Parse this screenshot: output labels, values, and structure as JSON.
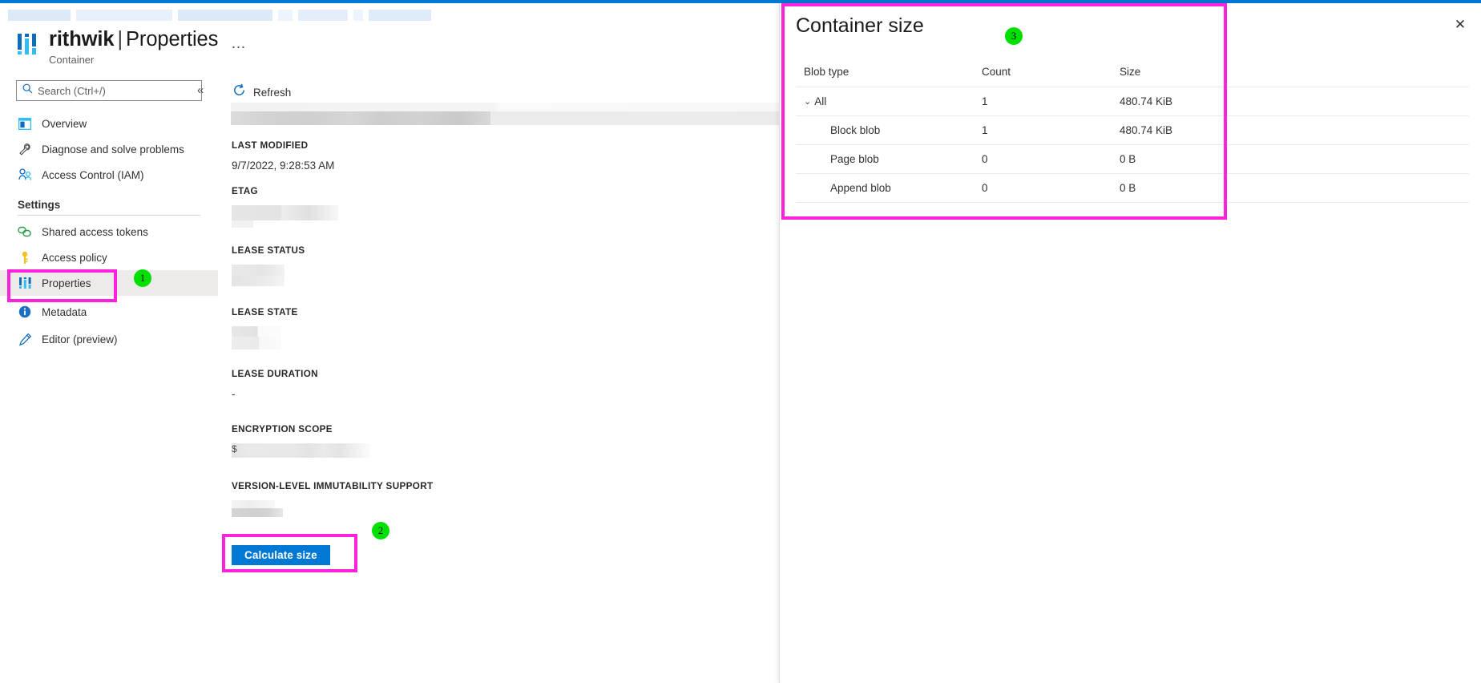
{
  "theme": {
    "azure_blue": "#0078d4",
    "highlight_pink": "#ff22dd",
    "badge_green": "#00e000"
  },
  "header": {
    "title_main": "rithwik",
    "title_separator": "|",
    "title_page": "Properties",
    "subtitle": "Container",
    "more_menu": "…",
    "resource_icon": "container-properties-icon"
  },
  "sidebar": {
    "search": {
      "placeholder": "Search (Ctrl+/)",
      "value": "",
      "icon": "search-icon"
    },
    "collapse": {
      "glyph": "«"
    },
    "items": [
      {
        "label": "Overview",
        "icon": "overview-icon",
        "selected": false
      },
      {
        "label": "Diagnose and solve problems",
        "icon": "wrench-icon",
        "selected": false
      },
      {
        "label": "Access Control (IAM)",
        "icon": "people-icon",
        "selected": false
      }
    ],
    "group_title": "Settings",
    "settings_items": [
      {
        "label": "Shared access tokens",
        "icon": "link-tokens-icon",
        "selected": false
      },
      {
        "label": "Access policy",
        "icon": "key-icon",
        "selected": false
      },
      {
        "label": "Properties",
        "icon": "properties-bars-icon",
        "selected": true
      },
      {
        "label": "Metadata",
        "icon": "info-icon",
        "selected": false
      },
      {
        "label": "Editor (preview)",
        "icon": "pencil-icon",
        "selected": false
      }
    ]
  },
  "toolbar": {
    "refresh_label": "Refresh",
    "refresh_icon": "refresh-icon"
  },
  "properties": [
    {
      "label": "LAST MODIFIED",
      "value": "9/7/2022, 9:28:53 AM",
      "redacted": false
    },
    {
      "label": "ETAG",
      "value": "",
      "redacted": true
    },
    {
      "label": "LEASE STATUS",
      "value": "",
      "redacted": true
    },
    {
      "label": "LEASE STATE",
      "value": "",
      "redacted": true
    },
    {
      "label": "LEASE DURATION",
      "value": "-",
      "redacted": false
    },
    {
      "label": "ENCRYPTION SCOPE",
      "value": "$",
      "redacted": true
    },
    {
      "label": "VERSION-LEVEL IMMUTABILITY SUPPORT",
      "value": "",
      "redacted": true
    }
  ],
  "calculate_button": {
    "label": "Calculate size"
  },
  "flyout": {
    "title": "Container size",
    "close_glyph": "✕",
    "table": {
      "columns": [
        "Blob type",
        "Count",
        "Size"
      ],
      "rows": [
        {
          "type": "All",
          "count": "1",
          "size": "480.74 KiB",
          "expandable": true,
          "indent": false
        },
        {
          "type": "Block blob",
          "count": "1",
          "size": "480.74 KiB",
          "expandable": false,
          "indent": true
        },
        {
          "type": "Page blob",
          "count": "0",
          "size": "0 B",
          "expandable": false,
          "indent": true
        },
        {
          "type": "Append blob",
          "count": "0",
          "size": "0 B",
          "expandable": false,
          "indent": true
        }
      ],
      "expand_glyph": "⌄"
    }
  },
  "annotations": [
    {
      "number": "1",
      "target": "sidebar-properties"
    },
    {
      "number": "2",
      "target": "calculate-size-button"
    },
    {
      "number": "3",
      "target": "container-size-panel"
    }
  ]
}
